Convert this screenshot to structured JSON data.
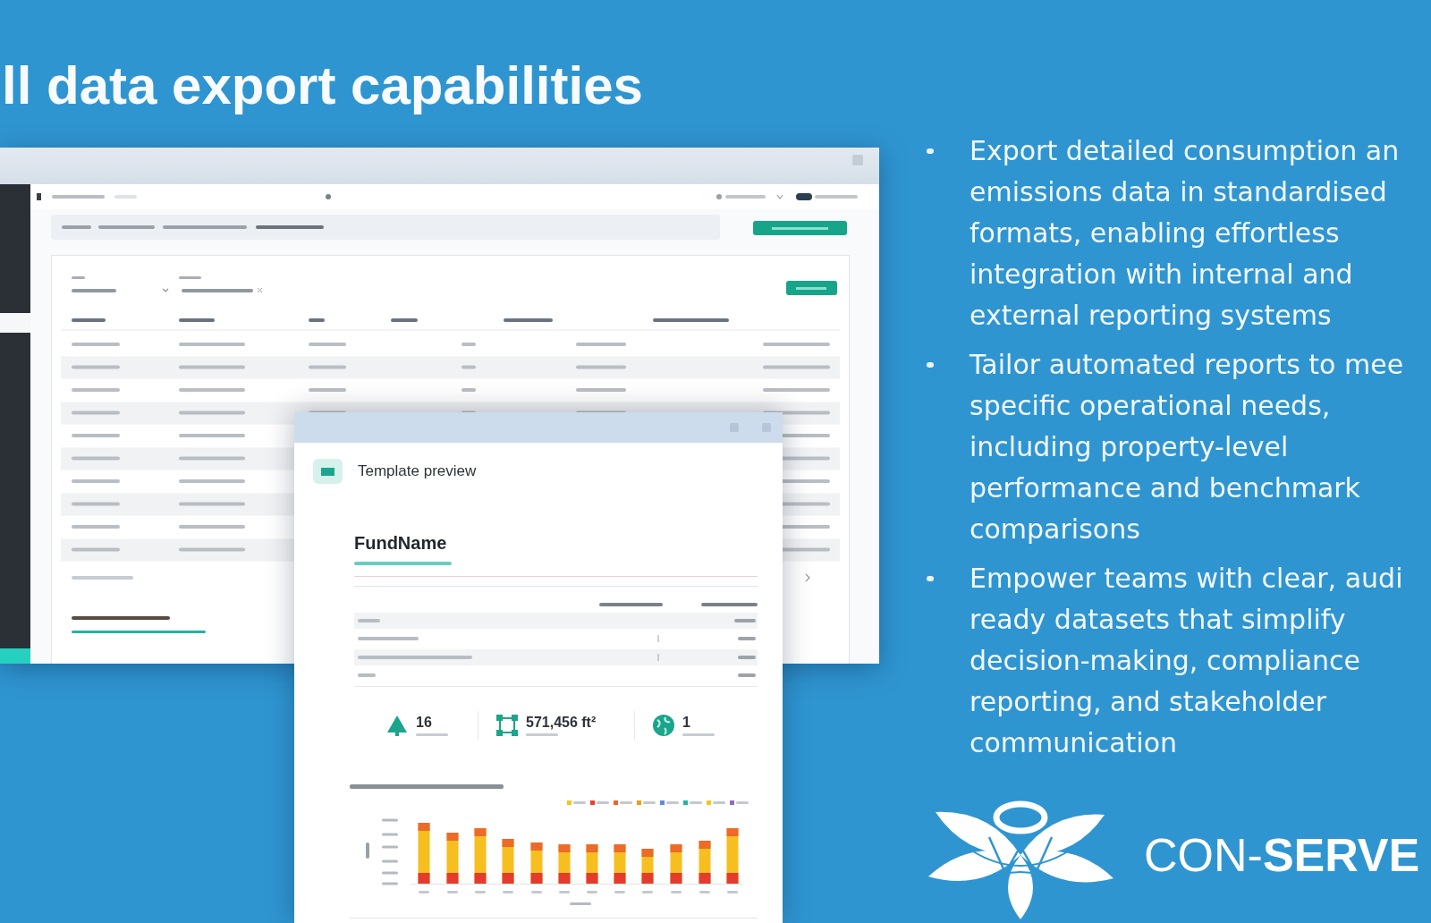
{
  "slide": {
    "title": "ll data export capabilities"
  },
  "preview_dialog": {
    "title": "Template preview",
    "fund_name": "FundName",
    "stats": [
      {
        "kind": "tree",
        "value": "16"
      },
      {
        "kind": "area",
        "value": "571,456 ft²"
      },
      {
        "kind": "globe",
        "value": "1"
      }
    ]
  },
  "bullets": [
    {
      "lines": [
        "Export detailed consumption an",
        "emissions data in standardised",
        "formats, enabling effortless",
        "integration with internal and",
        "external reporting systems"
      ]
    },
    {
      "lines": [
        "Tailor automated reports to mee",
        "specific operational needs,",
        "including property-level",
        "performance and benchmark",
        "comparisons"
      ]
    },
    {
      "lines": [
        "Empower teams with clear, audi",
        "ready datasets that simplify",
        "decision-making, compliance",
        "reporting, and stakeholder",
        "communication"
      ]
    }
  ],
  "logo": {
    "text": "CON-**SERVE**"
  }
}
